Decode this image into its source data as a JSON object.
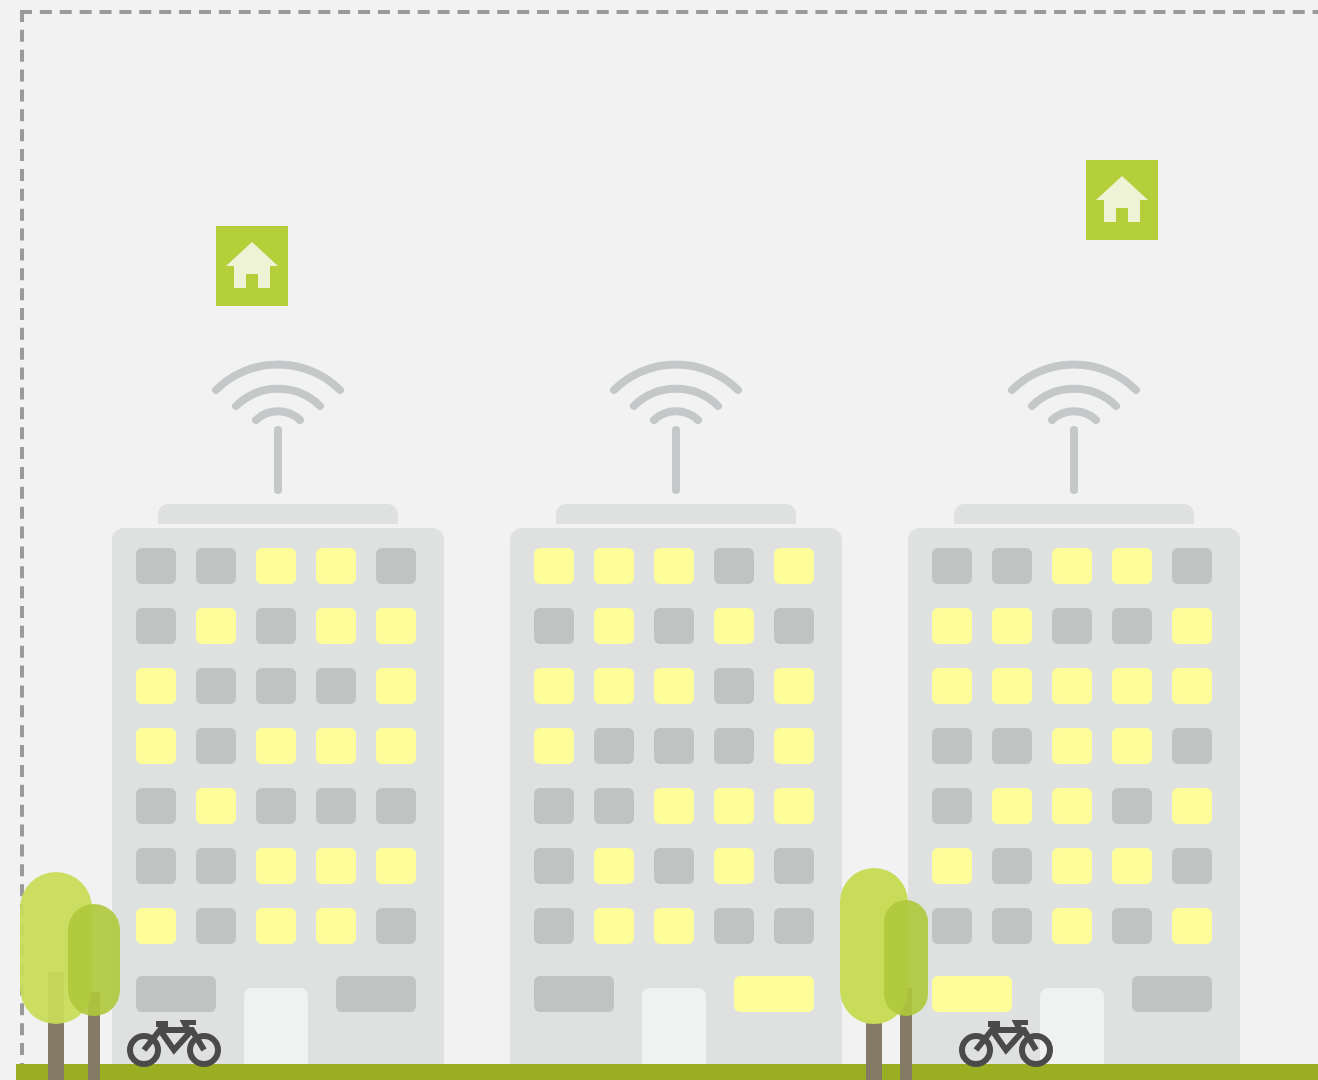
{
  "buildings": [
    {
      "home_badge": true,
      "windows": [
        [
          false,
          false,
          true,
          true,
          false
        ],
        [
          false,
          true,
          false,
          true,
          true
        ],
        [
          true,
          false,
          false,
          false,
          true
        ],
        [
          true,
          false,
          true,
          true,
          true
        ],
        [
          false,
          true,
          false,
          false,
          false
        ],
        [
          false,
          false,
          true,
          true,
          true
        ],
        [
          true,
          false,
          true,
          true,
          false
        ]
      ],
      "ground_windows": [
        false,
        false
      ]
    },
    {
      "home_badge": false,
      "windows": [
        [
          true,
          true,
          true,
          false,
          true
        ],
        [
          false,
          true,
          false,
          true,
          false
        ],
        [
          true,
          true,
          true,
          false,
          true
        ],
        [
          true,
          false,
          false,
          false,
          true
        ],
        [
          false,
          false,
          true,
          true,
          true
        ],
        [
          false,
          true,
          false,
          true,
          false
        ],
        [
          false,
          true,
          true,
          false,
          false
        ]
      ],
      "ground_windows": [
        false,
        true
      ]
    },
    {
      "home_badge": true,
      "windows": [
        [
          false,
          false,
          true,
          true,
          false
        ],
        [
          true,
          true,
          false,
          false,
          true
        ],
        [
          true,
          true,
          true,
          true,
          true
        ],
        [
          false,
          false,
          true,
          true,
          false
        ],
        [
          false,
          true,
          true,
          false,
          true
        ],
        [
          true,
          false,
          true,
          true,
          false
        ],
        [
          false,
          false,
          true,
          false,
          true
        ]
      ],
      "ground_windows": [
        true,
        false
      ]
    }
  ]
}
